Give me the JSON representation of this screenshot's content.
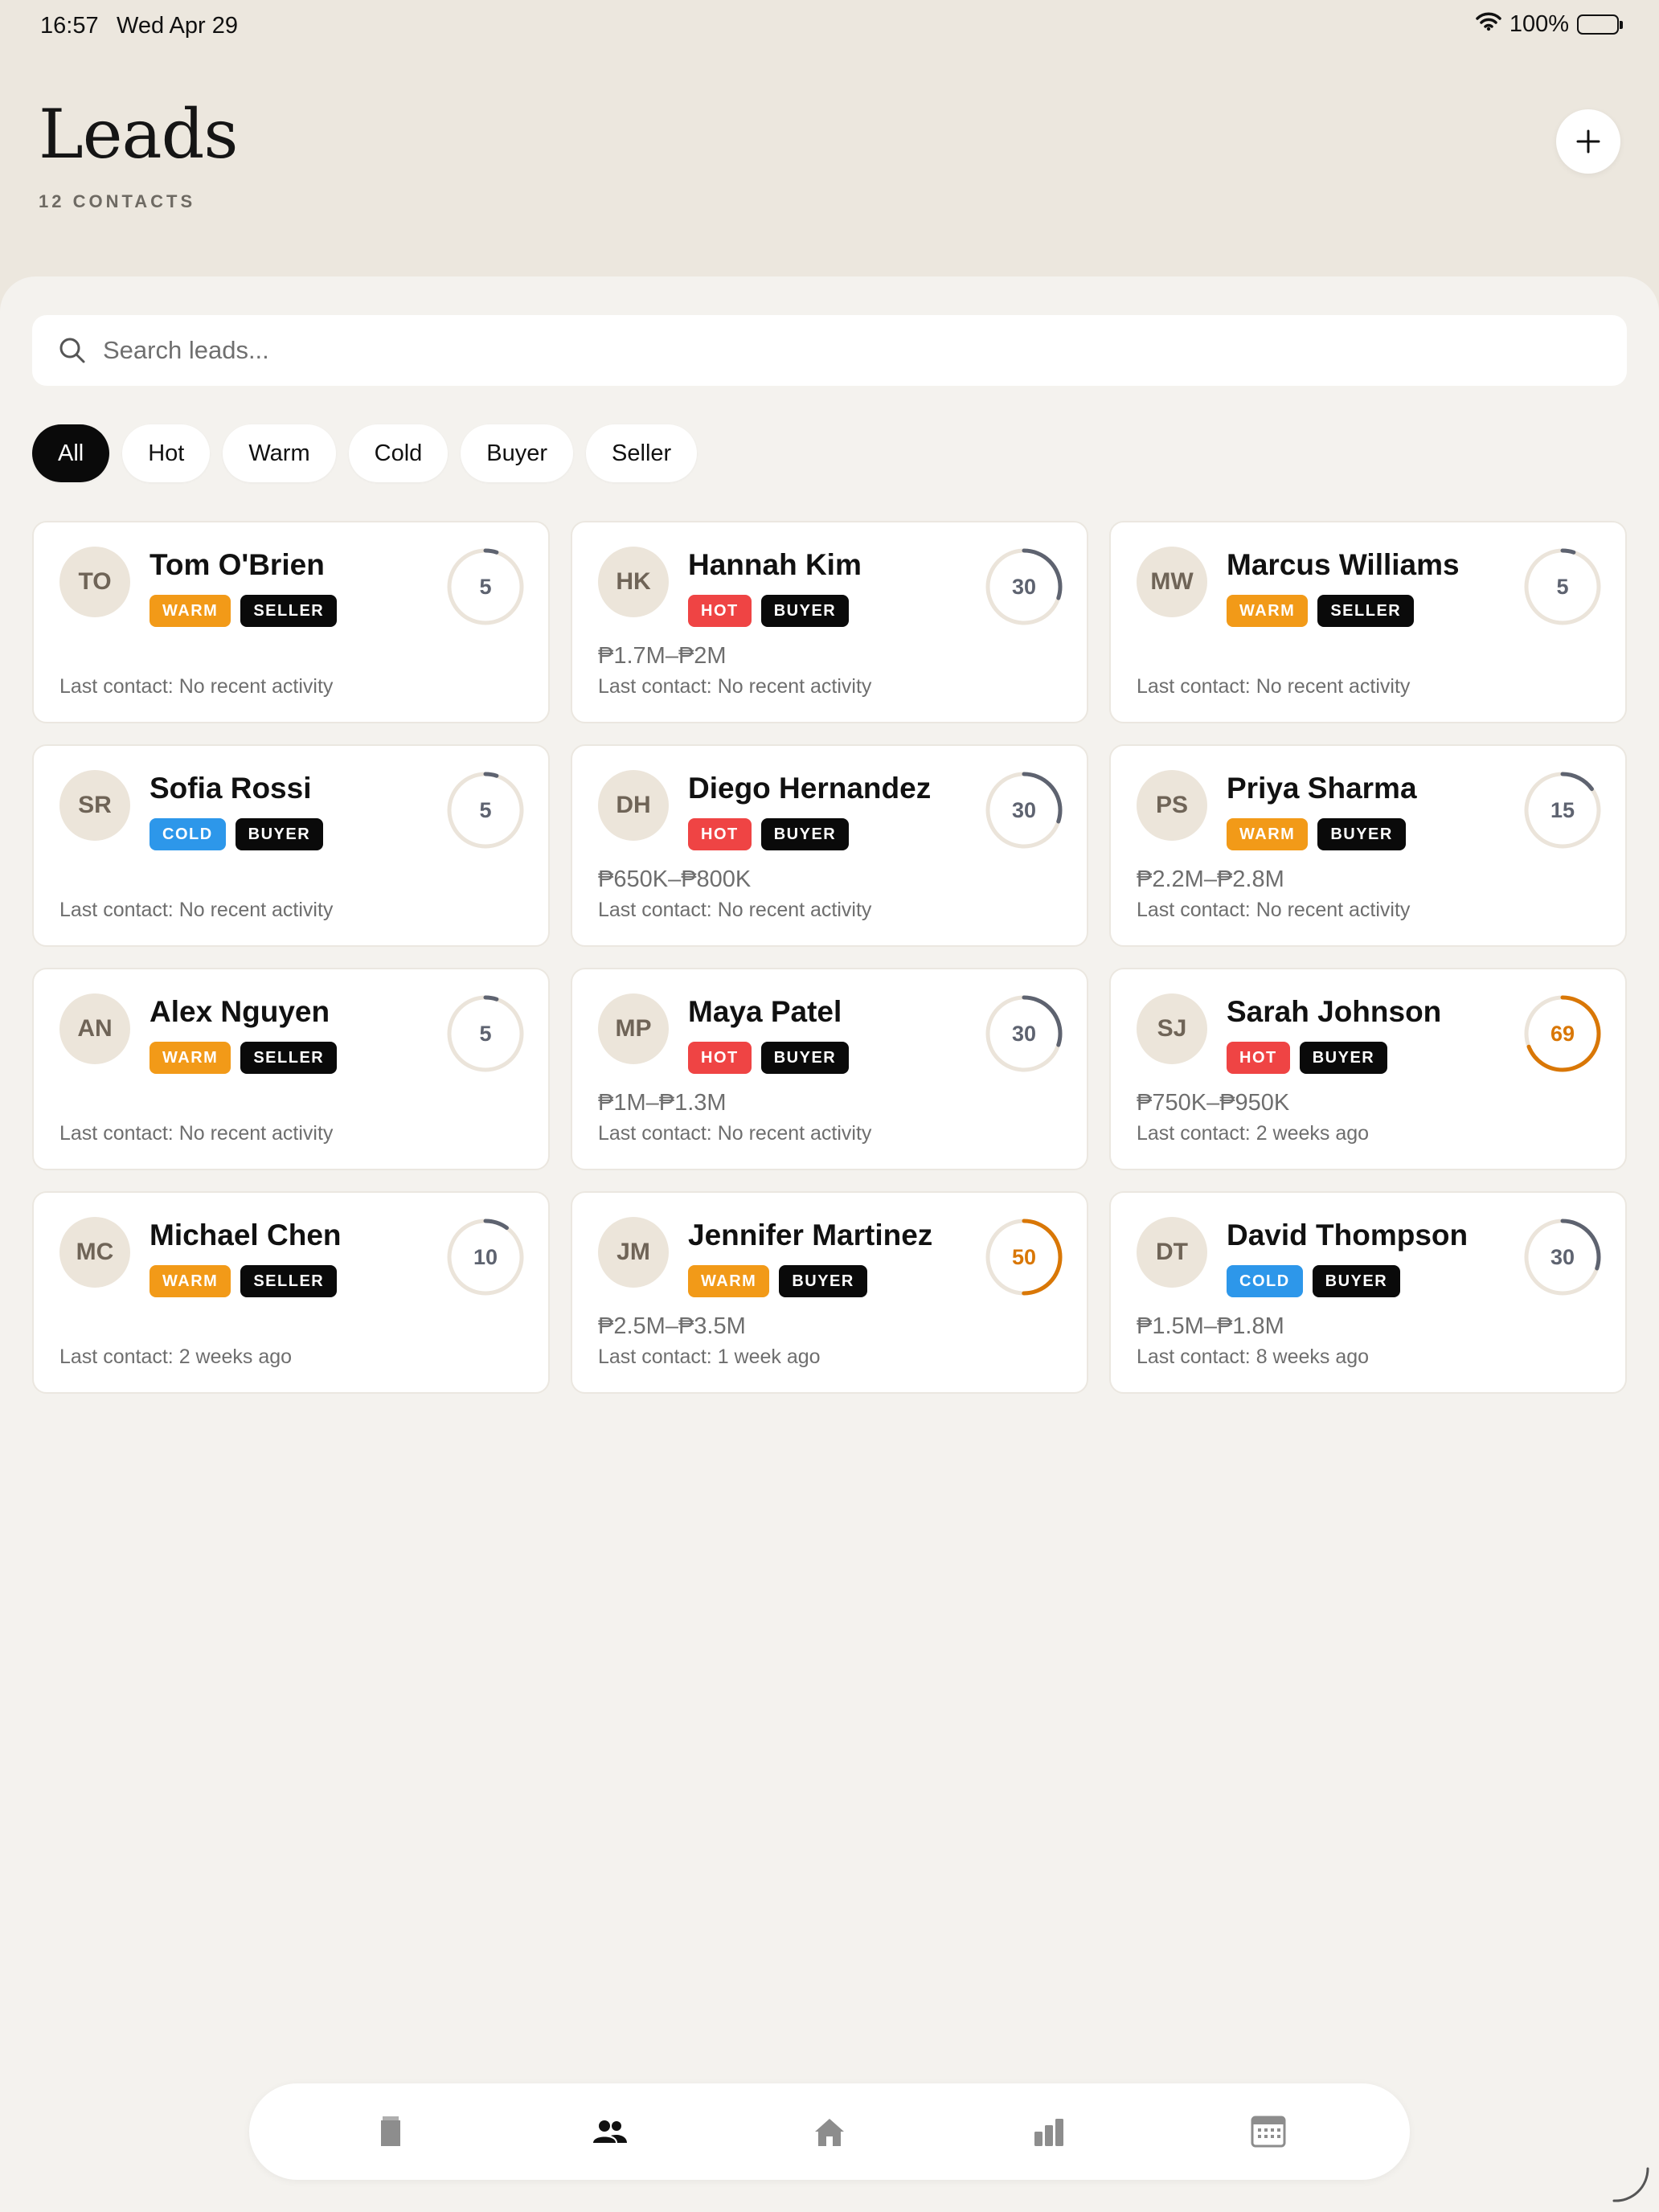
{
  "status": {
    "time": "16:57",
    "date": "Wed Apr 29",
    "battery": "100%"
  },
  "header": {
    "title": "Leads",
    "subtitle": "12 CONTACTS",
    "add_icon": "plus-icon"
  },
  "search": {
    "placeholder": "Search leads...",
    "value": ""
  },
  "filters": [
    "All",
    "Hot",
    "Warm",
    "Cold",
    "Buyer",
    "Seller"
  ],
  "active_filter": "All",
  "colors": {
    "warm": "#f29a18",
    "hot": "#ef4444",
    "cold": "#2d97ea",
    "role": "#0a0a0a",
    "score_high": "#d97706",
    "score_normal": "#5e6370"
  },
  "leads": [
    {
      "initials": "TO",
      "name": "Tom O'Brien",
      "temp": "WARM",
      "role": "SELLER",
      "price": "",
      "last": "Last contact: No recent activity",
      "score": 5
    },
    {
      "initials": "HK",
      "name": "Hannah Kim",
      "temp": "HOT",
      "role": "BUYER",
      "price": "₱1.7M–₱2M",
      "last": "Last contact: No recent activity",
      "score": 30
    },
    {
      "initials": "MW",
      "name": "Marcus Williams",
      "temp": "WARM",
      "role": "SELLER",
      "price": "",
      "last": "Last contact: No recent activity",
      "score": 5
    },
    {
      "initials": "SR",
      "name": "Sofia Rossi",
      "temp": "COLD",
      "role": "BUYER",
      "price": "",
      "last": "Last contact: No recent activity",
      "score": 5
    },
    {
      "initials": "DH",
      "name": "Diego Hernandez",
      "temp": "HOT",
      "role": "BUYER",
      "price": "₱650K–₱800K",
      "last": "Last contact: No recent activity",
      "score": 30
    },
    {
      "initials": "PS",
      "name": "Priya Sharma",
      "temp": "WARM",
      "role": "BUYER",
      "price": "₱2.2M–₱2.8M",
      "last": "Last contact: No recent activity",
      "score": 15
    },
    {
      "initials": "AN",
      "name": "Alex Nguyen",
      "temp": "WARM",
      "role": "SELLER",
      "price": "",
      "last": "Last contact: No recent activity",
      "score": 5
    },
    {
      "initials": "MP",
      "name": "Maya Patel",
      "temp": "HOT",
      "role": "BUYER",
      "price": "₱1M–₱1.3M",
      "last": "Last contact: No recent activity",
      "score": 30
    },
    {
      "initials": "SJ",
      "name": "Sarah Johnson",
      "temp": "HOT",
      "role": "BUYER",
      "price": "₱750K–₱950K",
      "last": "Last contact: 2 weeks ago",
      "score": 69
    },
    {
      "initials": "MC",
      "name": "Michael Chen",
      "temp": "WARM",
      "role": "SELLER",
      "price": "",
      "last": "Last contact: 2 weeks ago",
      "score": 10
    },
    {
      "initials": "JM",
      "name": "Jennifer Martinez",
      "temp": "WARM",
      "role": "BUYER",
      "price": "₱2.5M–₱3.5M",
      "last": "Last contact: 1 week ago",
      "score": 50
    },
    {
      "initials": "DT",
      "name": "David Thompson",
      "temp": "COLD",
      "role": "BUYER",
      "price": "₱1.5M–₱1.8M",
      "last": "Last contact: 8 weeks ago",
      "score": 30
    }
  ],
  "tabbar": {
    "items": [
      {
        "icon": "documents-icon",
        "active": false
      },
      {
        "icon": "people-icon",
        "active": true
      },
      {
        "icon": "home-icon",
        "active": false
      },
      {
        "icon": "bar-chart-icon",
        "active": false
      },
      {
        "icon": "calendar-icon",
        "active": false
      }
    ]
  }
}
